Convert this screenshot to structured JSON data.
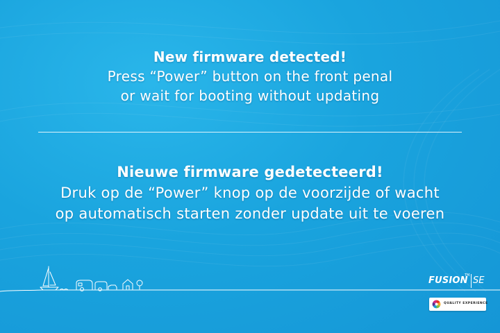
{
  "english": {
    "title": "New firmware detected!",
    "line1": "Press “Power” button on the front penal",
    "line2": "or wait for booting without updating"
  },
  "dutch": {
    "title": "Nieuwe firmware gedetecteerd!",
    "line1": "Druk op de “Power” knop op de voorzijde of wacht",
    "line2": "op automatisch starten zonder update uit te voeren"
  },
  "brand": {
    "name": "FUSION",
    "model": "SE",
    "trademark": "TM",
    "quality_label": "QUALITY EXPERIENCE"
  },
  "icons": {
    "scenery": "sailboat-caravans-house-scenery-icon",
    "quality": "quality-color-wheel-icon"
  },
  "colors": {
    "background": "#1aa4de",
    "text": "#ffffff"
  }
}
